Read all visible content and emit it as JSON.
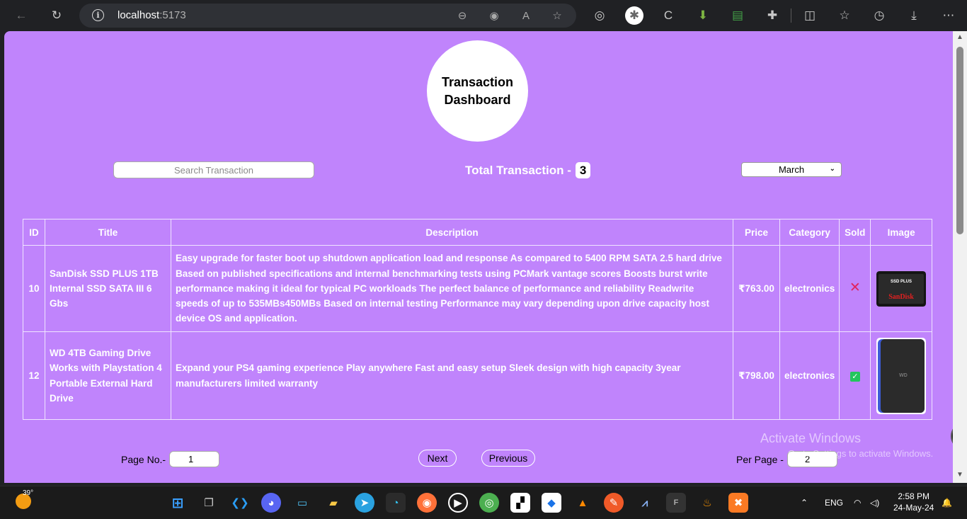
{
  "browser": {
    "url_host": "localhost",
    "url_port": ":5173"
  },
  "dashboard": {
    "title": "Transaction Dashboard",
    "search_placeholder": "Search Transaction",
    "total_label": "Total Transaction -",
    "total_count": "3",
    "month_selected": "March"
  },
  "table": {
    "headers": [
      "ID",
      "Title",
      "Description",
      "Price",
      "Category",
      "Sold",
      "Image"
    ],
    "rows": [
      {
        "id": "10",
        "title": "SanDisk SSD PLUS 1TB Internal SSD SATA III 6 Gbs",
        "description": "Easy upgrade for faster boot up shutdown application load and response As compared to 5400 RPM SATA 2.5 hard drive Based on published specifications and internal benchmarking tests using PCMark vantage scores Boosts burst write performance making it ideal for typical PC workloads The perfect balance of performance and reliability Readwrite speeds of up to 535MBs450MBs Based on internal testing Performance may vary depending upon drive capacity host device OS and application.",
        "price": "₹763.00",
        "category": "electronics",
        "sold": false,
        "image_label_top": "SSD PLUS",
        "image_label_brand": "SanDisk"
      },
      {
        "id": "12",
        "title": "WD 4TB Gaming Drive Works with Playstation 4 Portable External Hard Drive",
        "description": "Expand your PS4 gaming experience Play anywhere Fast and easy setup Sleek design with high capacity 3year manufacturers limited warranty",
        "price": "₹798.00",
        "category": "electronics",
        "sold": true
      }
    ]
  },
  "pagination": {
    "page_label": "Page No.-",
    "page_value": "1",
    "next_label": "Next",
    "previous_label": "Previous",
    "per_page_label": "Per Page -",
    "per_page_value": "2"
  },
  "watermark": {
    "line1": "Activate Windows",
    "line2": "Go to Settings to activate Windows."
  },
  "taskbar": {
    "weather_temp": "39°",
    "lang": "ENG",
    "time": "2:58 PM",
    "date": "24-May-24"
  }
}
